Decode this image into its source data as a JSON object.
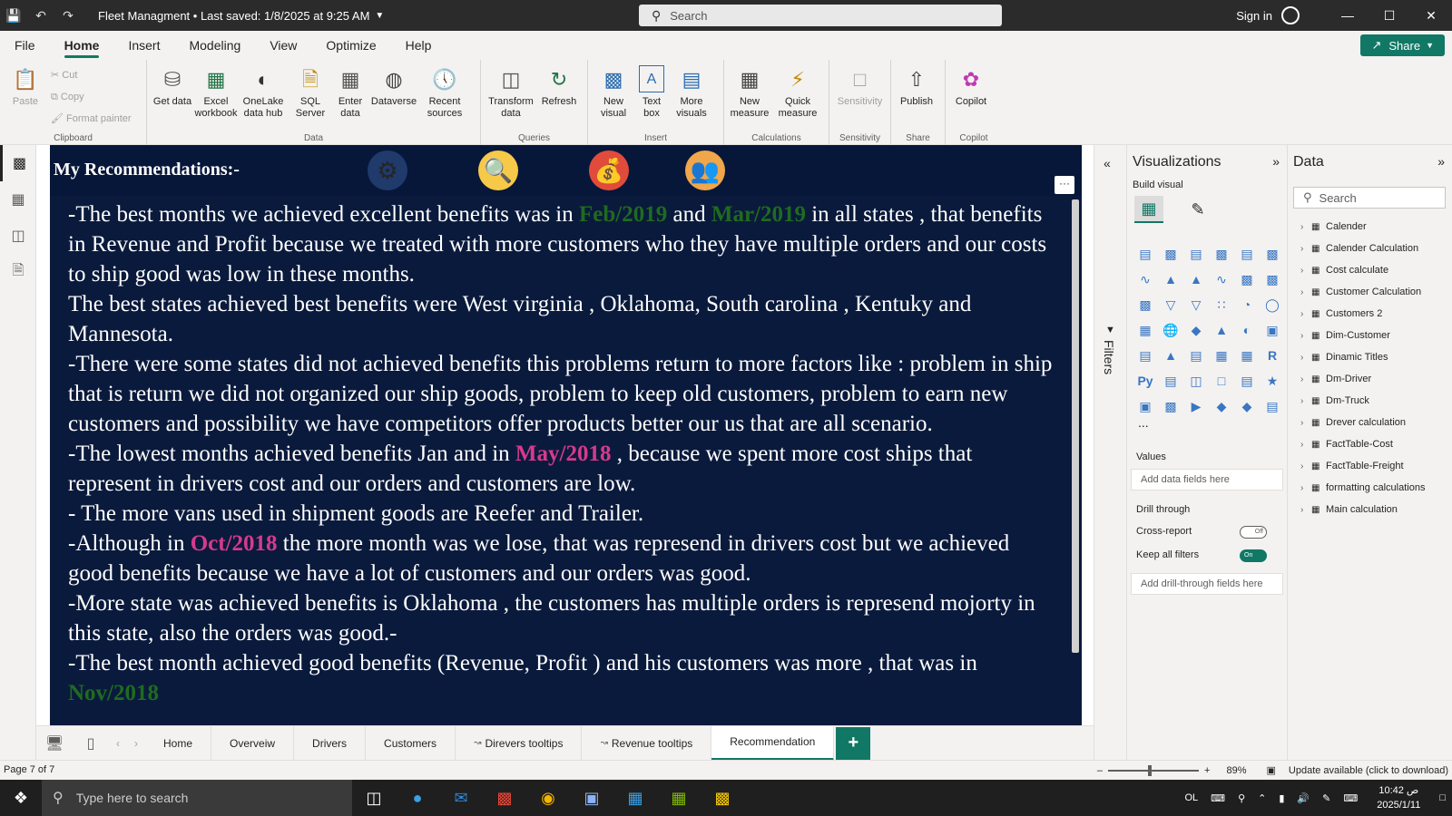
{
  "titlebar": {
    "title": "Fleet Managment • Last saved: 1/8/2025 at 9:25 AM",
    "search_placeholder": "Search",
    "signin": "Sign in"
  },
  "menu": {
    "tabs": [
      "File",
      "Home",
      "Insert",
      "Modeling",
      "View",
      "Optimize",
      "Help"
    ],
    "share": "Share"
  },
  "ribbon": {
    "clipboard": {
      "label": "Clipboard",
      "paste": "Paste",
      "cut": "Cut",
      "copy": "Copy",
      "format_painter": "Format painter"
    },
    "data": {
      "label": "Data",
      "get_data": "Get data",
      "excel": "Excel workbook",
      "onelake": "OneLake data hub",
      "sql": "SQL Server",
      "enter": "Enter data",
      "dataverse": "Dataverse",
      "recent": "Recent sources"
    },
    "queries": {
      "label": "Queries",
      "transform": "Transform data",
      "refresh": "Refresh"
    },
    "insert": {
      "label": "Insert",
      "new_visual": "New visual",
      "text_box": "Text box",
      "more_visuals": "More visuals"
    },
    "calculations": {
      "label": "Calculations",
      "new_measure": "New measure",
      "quick_measure": "Quick measure"
    },
    "sensitivity": {
      "label": "Sensitivity",
      "sensitivity": "Sensitivity"
    },
    "share": {
      "label": "Share",
      "publish": "Publish"
    },
    "copilot": {
      "label": "Copilot",
      "copilot": "Copilot"
    }
  },
  "canvas": {
    "title": "My Recommendations:-",
    "more": "···",
    "paragraphs": [
      {
        "parts": [
          {
            "t": "-The best months we achieved excellent benefits was in "
          },
          {
            "t": "Feb/2019",
            "c": "green"
          },
          {
            "t": " and "
          },
          {
            "t": "Mar/2019",
            "c": "green"
          },
          {
            "t": " in all states  , that benefits in Revenue and Profit because we treated with more customers who they have multiple orders and our costs to ship good was low in these months."
          }
        ]
      },
      {
        "parts": [
          {
            "t": "The best states achieved best benefits were West  virginia , Oklahoma, South carolina , Kentuky and Mannesota."
          }
        ]
      },
      {
        "parts": [
          {
            "t": "-There were some states did not achieved benefits this problems return to more factors like : problem in ship  that is return we did not organized our ship goods, problem to keep old customers, problem to earn new customers and possibility we have competitors offer products better our us that are all scenario."
          }
        ]
      },
      {
        "parts": [
          {
            "t": "-The lowest months achieved benefits Jan and in "
          },
          {
            "t": "May/2018",
            "c": "pink"
          },
          {
            "t": " , because we spent more cost ships that represent in drivers cost and our orders and customers are low."
          }
        ]
      },
      {
        "parts": [
          {
            "t": "- The more vans used in shipment goods are Reefer and Trailer."
          }
        ]
      },
      {
        "parts": [
          {
            "t": "-Although in "
          },
          {
            "t": "Oct/2018",
            "c": "pink"
          },
          {
            "t": "  the more month was we lose, that was represend in drivers cost but we achieved good benefits  because we have a lot of customers and our orders was good."
          }
        ]
      },
      {
        "parts": [
          {
            "t": "-More state was achieved benefits is Oklahoma , the customers has multiple orders is represend mojorty in this state, also the orders was good.-"
          }
        ]
      },
      {
        "parts": [
          {
            "t": "-The best month achieved good benefits (Revenue, Profit ) and his customers was more , that was in "
          },
          {
            "t": "Nov/2018",
            "c": "green"
          }
        ]
      }
    ]
  },
  "pages": {
    "tabs": [
      "Home",
      "Overveiw",
      "Drivers",
      "Customers",
      "Direvers tooltips",
      "Revenue tooltips",
      "Recommendation"
    ],
    "active": "Recommendation"
  },
  "filters": {
    "label": "Filters"
  },
  "viz": {
    "title": "Visualizations",
    "build_visual": "Build visual",
    "values_label": "Values",
    "values_placeholder": "Add data fields here",
    "drill_through": "Drill through",
    "cross_report": "Cross-report",
    "cross_report_state": "Off",
    "keep_all_filters": "Keep all filters",
    "keep_all_filters_state": "On",
    "drill_placeholder": "Add drill-through fields here",
    "more": "..."
  },
  "data_pane": {
    "title": "Data",
    "search_placeholder": "Search",
    "tables": [
      "Calender",
      "Calender Calculation",
      "Cost calculate",
      "Customer Calculation",
      "Customers 2",
      "Dim-Customer",
      "Dinamic Titles",
      "Dm-Driver",
      "Dm-Truck",
      "Drever calculation",
      "FactTable-Cost",
      "FactTable-Freight",
      "formatting calculations",
      "Main calculation"
    ]
  },
  "status": {
    "page": "Page 7 of 7",
    "zoom": "89%",
    "update": "Update available (click to download)"
  },
  "taskbar": {
    "search_placeholder": "Type here to search",
    "lang": "OL",
    "time": "10:42 ص",
    "date": "2025/1/11"
  },
  "colors": {
    "accent": "#117865",
    "canvas_bg": "#0a1a3c",
    "highlight_green": "#1f6b1f",
    "highlight_pink": "#d63a8c"
  }
}
